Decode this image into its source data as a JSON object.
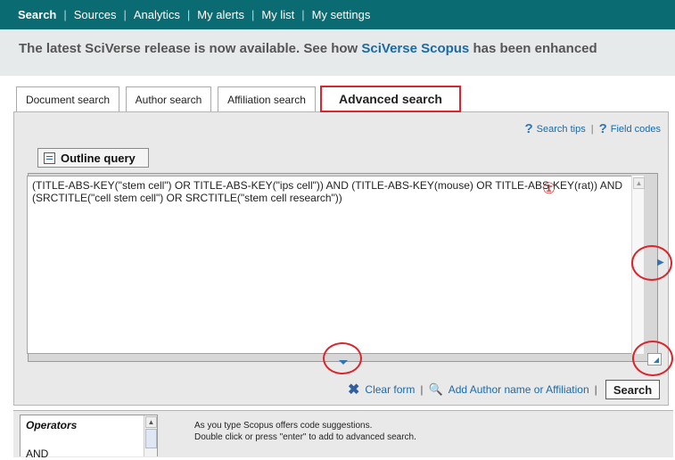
{
  "topnav": {
    "items": [
      "Search",
      "Sources",
      "Analytics",
      "My alerts",
      "My list",
      "My settings"
    ]
  },
  "banner": {
    "prefix": "The latest SciVerse release is now available. See how ",
    "link": "SciVerse Scopus",
    "suffix": " has been enhanced"
  },
  "tabs": [
    "Document search",
    "Author search",
    "Affiliation search",
    "Advanced search"
  ],
  "tips": {
    "search_tips": "Search tips",
    "field_codes": "Field codes"
  },
  "outline_button": "Outline query",
  "query": "(TITLE-ABS-KEY(\"stem cell\") OR  TITLE-ABS-KEY(\"ips cell\")) AND (TITLE-ABS-KEY(mouse) OR  TITLE-ABS-KEY(rat)) AND (SRCTITLE(\"cell stem cell\") OR SRCTITLE(\"stem cell research\"))",
  "marker": "①",
  "actions": {
    "clear_form": "Clear form",
    "add_author": "Add Author name or Affiliation",
    "search": "Search"
  },
  "operators": {
    "title": "Operators",
    "first_item": "AND"
  },
  "hint": {
    "line1": "As you type Scopus offers code suggestions.",
    "line2": "Double click or press \"enter\" to add to advanced search."
  },
  "colors": {
    "nav_bg": "#0b6b73",
    "highlight_red": "#d9252c",
    "link_blue": "#1b6aa6"
  }
}
